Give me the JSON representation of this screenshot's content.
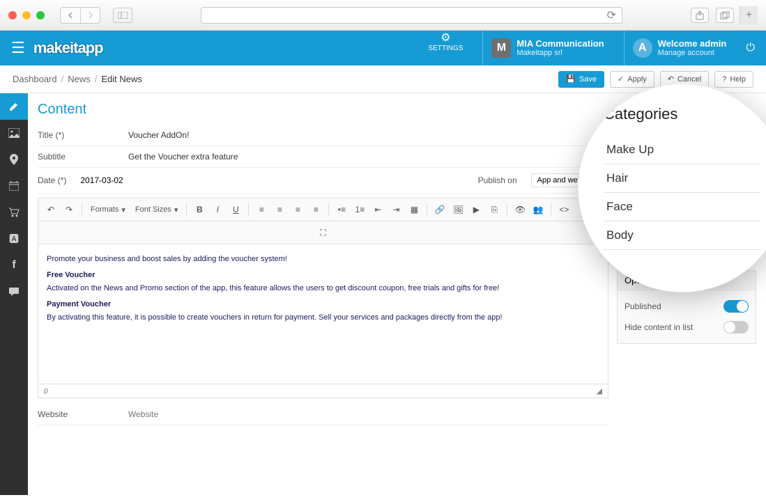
{
  "header": {
    "logo": "makeitapp",
    "settings_label": "SETTINGS",
    "org_badge": "M",
    "org_name": "MIA Communication",
    "org_sub": "Makeitapp srl",
    "user_badge": "A",
    "welcome": "Welcome admin",
    "manage": "Manage account"
  },
  "breadcrumb": {
    "items": [
      "Dashboard",
      "News",
      "Edit News"
    ],
    "save": "Save",
    "apply": "Apply",
    "cancel": "Cancel",
    "help": "Help"
  },
  "content": {
    "title": "Content",
    "fields": {
      "title_label": "Title (*)",
      "title_value": "Voucher AddOn!",
      "subtitle_label": "Subtitle",
      "subtitle_value": "Get the Voucher extra feature",
      "date_label": "Date (*)",
      "date_value": "2017-03-02",
      "publish_label": "Publish on",
      "publish_value": "App and website",
      "website_label": "Website",
      "website_placeholder": "Website"
    },
    "toolbar": {
      "formats": "Formats",
      "fontsizes": "Font Sizes"
    },
    "body": {
      "p1": "Promote your business and boost sales by adding the voucher system!",
      "h1": "Free Voucher",
      "p2": "Activated on the News and Promo section of the app, this feature allows the users to get discount coupon, free trials and gifts for free!",
      "h2": "Payment Voucher",
      "p3": "By activating this feature, it is possible to create vouchers in return for payment. Sell your services and packages directly from the app!"
    },
    "status_path": "p"
  },
  "options": {
    "card_title": "Options",
    "published_label": "Published",
    "published_on": true,
    "hide_label": "Hide content in list",
    "hide_on": false
  },
  "categories": {
    "title": "Categories",
    "items": [
      "Make Up",
      "Hair",
      "Face",
      "Body"
    ]
  }
}
